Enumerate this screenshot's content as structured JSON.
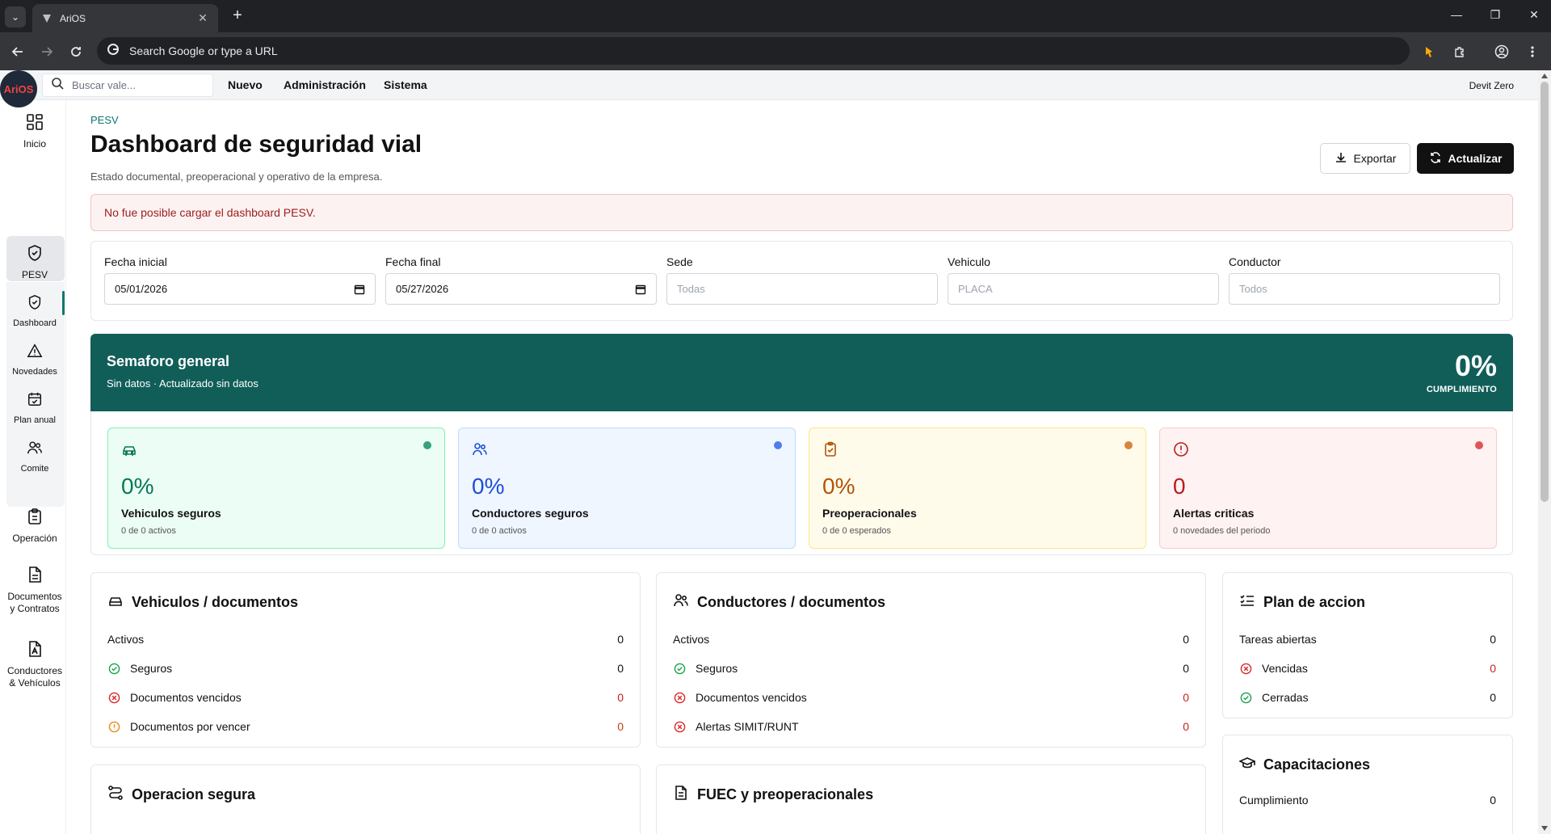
{
  "browser": {
    "tab_title": "AriOS",
    "omnibox_placeholder": "Search Google or type a URL"
  },
  "app": {
    "logo": "AriOS",
    "search_placeholder": "Buscar vale...",
    "menu": [
      "Nuevo",
      "Administración",
      "Sistema"
    ],
    "user": "Devit Zero"
  },
  "sidebar": {
    "items": [
      {
        "label": "Inicio",
        "icon": "grid-icon"
      },
      {
        "label": "PESV",
        "icon": "shield-icon"
      },
      {
        "label": "Dashboard",
        "icon": "shield-icon"
      },
      {
        "label": "Novedades",
        "icon": "warning-icon"
      },
      {
        "label": "Plan anual",
        "icon": "calendar-icon"
      },
      {
        "label": "Comite",
        "icon": "users-icon"
      },
      {
        "label": "Operación",
        "icon": "clipboard-icon"
      },
      {
        "label": "Documentos y Contratos",
        "icon": "document-icon"
      },
      {
        "label": "Conductores & Vehículos",
        "icon": "id-card-icon"
      }
    ]
  },
  "page": {
    "eyebrow": "PESV",
    "title": "Dashboard de seguridad vial",
    "subtitle": "Estado documental, preoperacional y operativo de la empresa.",
    "export_label": "Exportar",
    "refresh_label": "Actualizar",
    "error": "No fue posible cargar el dashboard PESV."
  },
  "filters": {
    "fecha_inicial": {
      "label": "Fecha inicial",
      "value": "05/01/2026"
    },
    "fecha_final": {
      "label": "Fecha final",
      "value": "05/27/2026"
    },
    "sede": {
      "label": "Sede",
      "placeholder": "Todas"
    },
    "vehiculo": {
      "label": "Vehiculo",
      "placeholder": "PLACA"
    },
    "conductor": {
      "label": "Conductor",
      "placeholder": "Todos"
    }
  },
  "semaforo": {
    "title": "Semaforo general",
    "subtitle": "Sin datos · Actualizado sin datos",
    "percent": "0%",
    "caption": "CUMPLIMIENTO"
  },
  "kpis": [
    {
      "value": "0%",
      "name": "Vehiculos seguros",
      "sub": "0 de 0 activos",
      "color": "#047857"
    },
    {
      "value": "0%",
      "name": "Conductores seguros",
      "sub": "0 de 0 activos",
      "color": "#1d4ed8"
    },
    {
      "value": "0%",
      "name": "Preoperacionales",
      "sub": "0 de 0 esperados",
      "color": "#b45309"
    },
    {
      "value": "0",
      "name": "Alertas criticas",
      "sub": "0 novedades del periodo",
      "color": "#b91c1c"
    }
  ],
  "cards": {
    "vehiculos": {
      "title": "Vehiculos / documentos",
      "rows": [
        {
          "label": "Activos",
          "value": "0"
        },
        {
          "label": "Seguros",
          "value": "0"
        },
        {
          "label": "Documentos vencidos",
          "value": "0"
        },
        {
          "label": "Documentos por vencer",
          "value": "0"
        }
      ]
    },
    "conductores": {
      "title": "Conductores / documentos",
      "rows": [
        {
          "label": "Activos",
          "value": "0"
        },
        {
          "label": "Seguros",
          "value": "0"
        },
        {
          "label": "Documentos vencidos",
          "value": "0"
        },
        {
          "label": "Alertas SIMIT/RUNT",
          "value": "0"
        }
      ]
    },
    "plan": {
      "title": "Plan de accion",
      "rows": [
        {
          "label": "Tareas abiertas",
          "value": "0"
        },
        {
          "label": "Vencidas",
          "value": "0"
        },
        {
          "label": "Cerradas",
          "value": "0"
        }
      ]
    },
    "operacion": {
      "title": "Operacion segura"
    },
    "fuec": {
      "title": "FUEC y preoperacionales"
    },
    "capacitaciones": {
      "title": "Capacitaciones",
      "rows": [
        {
          "label": "Cumplimiento",
          "value": "0"
        }
      ]
    }
  }
}
